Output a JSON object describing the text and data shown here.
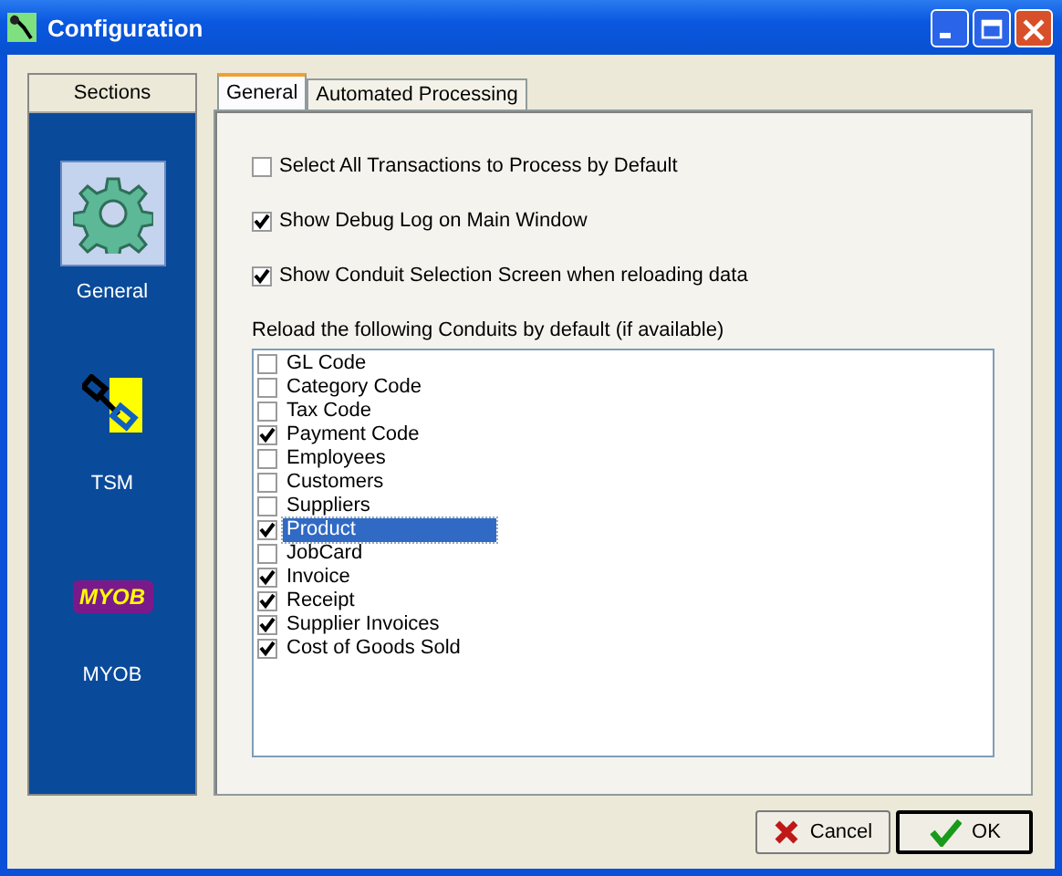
{
  "window": {
    "title": "Configuration"
  },
  "sidebar": {
    "header": "Sections",
    "items": [
      {
        "label": "General",
        "kind": "gear",
        "selected": true
      },
      {
        "label": "TSM",
        "kind": "chain",
        "selected": false
      },
      {
        "label": "MYOB",
        "kind": "logo",
        "logo_text": "MYOB",
        "selected": false
      }
    ]
  },
  "tabs": [
    {
      "label": "General",
      "selected": true
    },
    {
      "label": "Automated Processing",
      "selected": false
    }
  ],
  "options": [
    {
      "label": "Select All Transactions to Process by Default",
      "checked": false
    },
    {
      "label": "Show Debug Log on Main Window",
      "checked": true
    },
    {
      "label": "Show Conduit Selection Screen when reloading data",
      "checked": true
    }
  ],
  "conduits": {
    "label": "Reload the following Conduits by default (if available)",
    "items": [
      {
        "label": "GL Code",
        "checked": false,
        "selected": false
      },
      {
        "label": "Category Code",
        "checked": false,
        "selected": false
      },
      {
        "label": "Tax Code",
        "checked": false,
        "selected": false
      },
      {
        "label": "Payment Code",
        "checked": true,
        "selected": false
      },
      {
        "label": "Employees",
        "checked": false,
        "selected": false
      },
      {
        "label": "Customers",
        "checked": false,
        "selected": false
      },
      {
        "label": "Suppliers",
        "checked": false,
        "selected": false
      },
      {
        "label": "Product",
        "checked": true,
        "selected": true
      },
      {
        "label": "JobCard",
        "checked": false,
        "selected": false
      },
      {
        "label": "Invoice",
        "checked": true,
        "selected": false
      },
      {
        "label": "Receipt",
        "checked": true,
        "selected": false
      },
      {
        "label": "Supplier Invoices",
        "checked": true,
        "selected": false
      },
      {
        "label": "Cost of Goods Sold",
        "checked": true,
        "selected": false
      }
    ]
  },
  "buttons": [
    {
      "label": "Cancel",
      "kind": "cancel"
    },
    {
      "label": "OK",
      "kind": "ok"
    }
  ]
}
